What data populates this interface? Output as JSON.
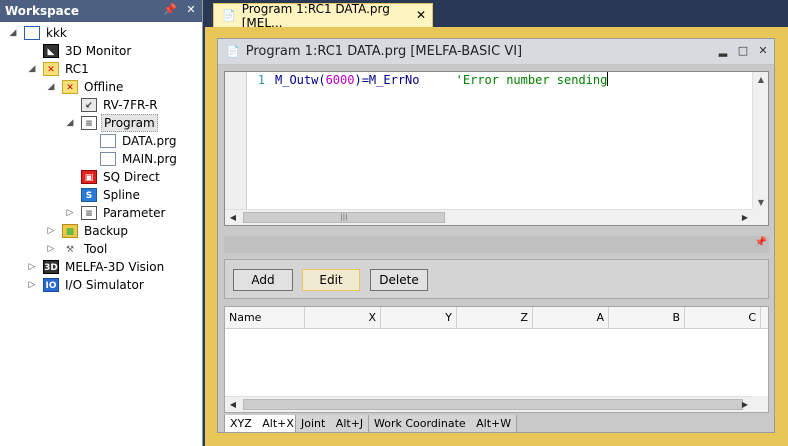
{
  "workspace": {
    "title": "Workspace",
    "pin_glyph": "▼",
    "tree": [
      {
        "label": "kkk",
        "icon": "project-icon",
        "level": 0,
        "expander": "◢"
      },
      {
        "label": "3D Monitor",
        "icon": "monitor-3d-icon",
        "level": 1,
        "expander": ""
      },
      {
        "label": "RC1",
        "icon": "robot-controller-icon",
        "level": 1,
        "expander": "◢"
      },
      {
        "label": "Offline",
        "icon": "offline-icon",
        "level": 2,
        "expander": "◢"
      },
      {
        "label": "RV-7FR-R",
        "icon": "robot-icon",
        "level": 3,
        "expander": ""
      },
      {
        "label": "Program",
        "icon": "program-icon",
        "level": 3,
        "expander": "◢",
        "selected": true
      },
      {
        "label": "DATA.prg",
        "icon": "file-icon",
        "level": 4,
        "expander": ""
      },
      {
        "label": "MAIN.prg",
        "icon": "file-icon",
        "level": 4,
        "expander": ""
      },
      {
        "label": "SQ Direct",
        "icon": "sq-direct-icon",
        "level": 3,
        "expander": ""
      },
      {
        "label": "Spline",
        "icon": "spline-icon",
        "level": 3,
        "expander": ""
      },
      {
        "label": "Parameter",
        "icon": "parameter-icon",
        "level": 3,
        "expander": "▷"
      },
      {
        "label": "Backup",
        "icon": "backup-icon",
        "level": 2,
        "expander": "▷"
      },
      {
        "label": "Tool",
        "icon": "tool-icon",
        "level": 2,
        "expander": "▷"
      },
      {
        "label": "MELFA-3D Vision",
        "icon": "vision-3d-icon",
        "level": 1,
        "expander": "▷"
      },
      {
        "label": "I/O Simulator",
        "icon": "io-simulator-icon",
        "level": 1,
        "expander": "▷"
      }
    ]
  },
  "doc_tab": {
    "label": "Program 1:RC1 DATA.prg   [MEL...",
    "close": "✕"
  },
  "child_window": {
    "title": "Program 1:RC1 DATA.prg   [MELFA-BASIC VI]"
  },
  "editor": {
    "line_number": "1",
    "code_parts": {
      "p1": "M_Outw(",
      "p2": "6000",
      "p3": ")=M_ErrNo",
      "p4": "     'Error number sending"
    }
  },
  "position_panel": {
    "buttons": {
      "add": "Add",
      "edit": "Edit",
      "delete": "Delete"
    },
    "columns": [
      "Name",
      "X",
      "Y",
      "Z",
      "A",
      "B",
      "C"
    ]
  },
  "bottom_tabs": [
    {
      "label": "XYZ   Alt+X",
      "active": true
    },
    {
      "label": "Joint   Alt+J",
      "active": false
    },
    {
      "label": "Work Coordinate   Alt+W",
      "active": false
    }
  ]
}
